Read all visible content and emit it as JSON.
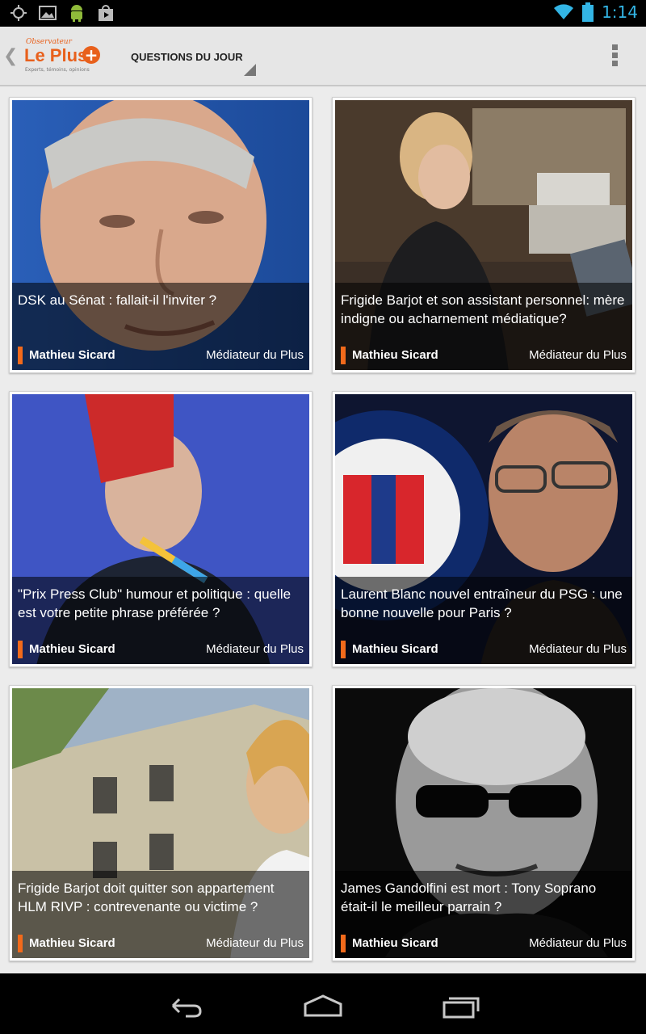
{
  "statusbar": {
    "time": "1:14",
    "icons": [
      "gps-icon",
      "image-icon",
      "android-icon",
      "store-icon",
      "wifi-icon",
      "battery-icon"
    ]
  },
  "appbar": {
    "logo": {
      "small": "Observateur",
      "main": "Le Plus",
      "plus_sign": "+",
      "tagline": "Experts, témoins, opinions"
    },
    "section_title": "QUESTIONS DU JOUR",
    "icons": [
      "back-chevron-icon",
      "dropdown-triangle-icon",
      "overflow-menu-icon"
    ]
  },
  "articles": [
    {
      "title": "DSK au Sénat : fallait-il l'inviter ?",
      "author": "Mathieu Sicard",
      "role": "Médiateur du Plus"
    },
    {
      "title": "Frigide Barjot et son assistant personnel: mère indigne ou acharnement médiatique?",
      "author": "Mathieu Sicard",
      "role": "Médiateur du Plus"
    },
    {
      "title": "\"Prix Press Club\" humour et politique : quelle est votre petite phrase préférée ?",
      "author": "Mathieu Sicard",
      "role": "Médiateur du Plus"
    },
    {
      "title": "Laurent Blanc nouvel entraîneur du PSG : une bonne nouvelle pour Paris ?",
      "author": "Mathieu Sicard",
      "role": "Médiateur du Plus"
    },
    {
      "title": "Frigide Barjot doit quitter son appartement HLM RIVP : contrevenante ou victime ?",
      "author": "Mathieu Sicard",
      "role": "Médiateur du Plus"
    },
    {
      "title": "James Gandolfini est mort : Tony Soprano était-il le meilleur parrain ?",
      "author": "Mathieu Sicard",
      "role": "Médiateur du Plus"
    }
  ],
  "colors": {
    "accent": "#f26a1b",
    "brand": "#e8601c",
    "clock": "#33b5e5"
  },
  "navbar": {
    "icons": [
      "back-icon",
      "home-icon",
      "recent-apps-icon"
    ]
  }
}
